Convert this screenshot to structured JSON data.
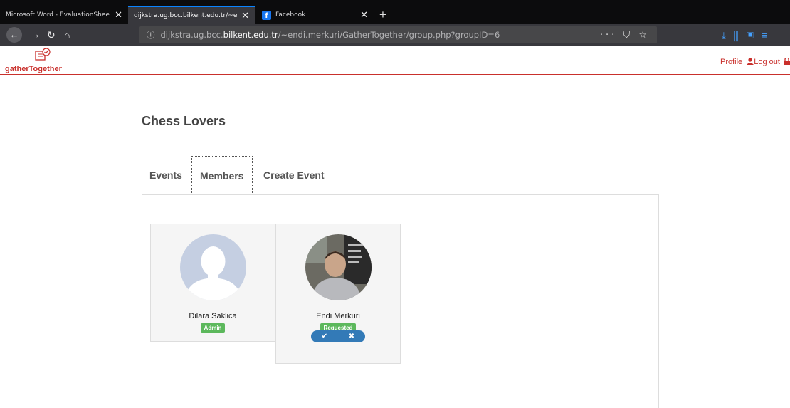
{
  "browser": {
    "tabs": [
      {
        "title": "Microsoft Word - EvaluationSheet.d",
        "close": "✕"
      },
      {
        "title": "dijkstra.ug.bcc.bilkent.edu.tr/~endi",
        "close": "✕"
      },
      {
        "title": "Facebook",
        "close": "✕"
      }
    ],
    "new_tab": "+",
    "url": {
      "info_icon": "ⓘ",
      "prefix": "dijkstra.ug.bcc.",
      "host": "bilkent.edu.tr",
      "suffix": "/~endi.merkuri/GatherTogether/group.php?groupID=6"
    },
    "url_right_icons": "··· ⛉ ☆",
    "toolbar_right_icons": "⤓  ⫼  ▣  ≡"
  },
  "app": {
    "brand": "gatherTogether",
    "profile_link": "Profile",
    "logout_link": "Log out",
    "brand_color": "#c9302c"
  },
  "group": {
    "title": "Chess Lovers",
    "tabs": [
      "Events",
      "Members",
      "Create Event"
    ],
    "selected_tab": "Members"
  },
  "members": [
    {
      "name": "Dilara Saklica",
      "badge": "Admin"
    },
    {
      "name": "Endi Merkuri",
      "badge": "Requested",
      "accept_icon": "✔",
      "reject_icon": "✖"
    }
  ]
}
